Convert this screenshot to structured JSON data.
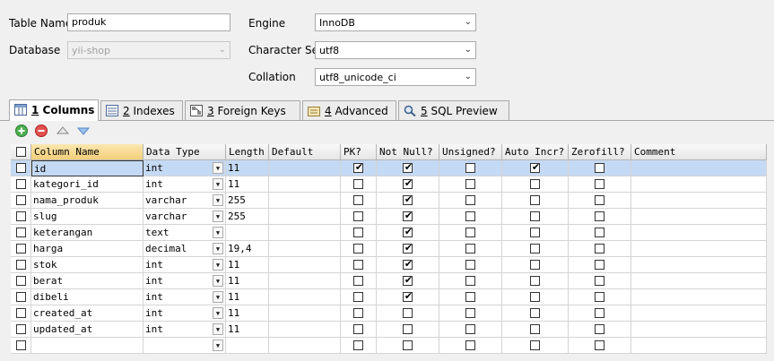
{
  "form": {
    "table_name_label": "Table Name",
    "table_name_value": "produk",
    "database_label": "Database",
    "database_value": "yii-shop",
    "engine_label": "Engine",
    "engine_value": "InnoDB",
    "charset_label": "Character Set",
    "charset_value": "utf8",
    "collation_label": "Collation",
    "collation_value": "utf8_unicode_ci"
  },
  "tabs": [
    {
      "num": "1",
      "label": " Columns",
      "icon": "columns-icon",
      "active": true
    },
    {
      "num": "2",
      "label": " Indexes",
      "icon": "indexes-icon",
      "active": false
    },
    {
      "num": "3",
      "label": " Foreign Keys",
      "icon": "foreign-keys-icon",
      "active": false
    },
    {
      "num": "4",
      "label": " Advanced",
      "icon": "advanced-icon",
      "active": false
    },
    {
      "num": "5",
      "label": " SQL Preview",
      "icon": "sql-preview-icon",
      "active": false
    }
  ],
  "toolbar": [
    "add-column-icon",
    "delete-column-icon",
    "move-up-icon",
    "move-down-icon"
  ],
  "columns_header": [
    "Column Name",
    "Data Type",
    "Length",
    "Default",
    "PK?",
    "Not Null?",
    "Unsigned?",
    "Auto Incr?",
    "Zerofill?",
    "Comment"
  ],
  "rows": [
    {
      "name": "id",
      "type": "int",
      "length": "11",
      "default": "",
      "pk": true,
      "notnull": true,
      "unsigned": false,
      "autoinc": true,
      "zerofill": false,
      "comment": ""
    },
    {
      "name": "kategori_id",
      "type": "int",
      "length": "11",
      "default": "",
      "pk": false,
      "notnull": true,
      "unsigned": false,
      "autoinc": false,
      "zerofill": false,
      "comment": ""
    },
    {
      "name": "nama_produk",
      "type": "varchar",
      "length": "255",
      "default": "",
      "pk": false,
      "notnull": true,
      "unsigned": false,
      "autoinc": false,
      "zerofill": false,
      "comment": ""
    },
    {
      "name": "slug",
      "type": "varchar",
      "length": "255",
      "default": "",
      "pk": false,
      "notnull": true,
      "unsigned": false,
      "autoinc": false,
      "zerofill": false,
      "comment": ""
    },
    {
      "name": "keterangan",
      "type": "text",
      "length": "",
      "default": "",
      "pk": false,
      "notnull": true,
      "unsigned": false,
      "autoinc": false,
      "zerofill": false,
      "comment": ""
    },
    {
      "name": "harga",
      "type": "decimal",
      "length": "19,4",
      "default": "",
      "pk": false,
      "notnull": true,
      "unsigned": false,
      "autoinc": false,
      "zerofill": false,
      "comment": ""
    },
    {
      "name": "stok",
      "type": "int",
      "length": "11",
      "default": "",
      "pk": false,
      "notnull": true,
      "unsigned": false,
      "autoinc": false,
      "zerofill": false,
      "comment": ""
    },
    {
      "name": "berat",
      "type": "int",
      "length": "11",
      "default": "",
      "pk": false,
      "notnull": true,
      "unsigned": false,
      "autoinc": false,
      "zerofill": false,
      "comment": ""
    },
    {
      "name": "dibeli",
      "type": "int",
      "length": "11",
      "default": "",
      "pk": false,
      "notnull": true,
      "unsigned": false,
      "autoinc": false,
      "zerofill": false,
      "comment": ""
    },
    {
      "name": "created_at",
      "type": "int",
      "length": "11",
      "default": "",
      "pk": false,
      "notnull": false,
      "unsigned": false,
      "autoinc": false,
      "zerofill": false,
      "comment": ""
    },
    {
      "name": "updated_at",
      "type": "int",
      "length": "11",
      "default": "",
      "pk": false,
      "notnull": false,
      "unsigned": false,
      "autoinc": false,
      "zerofill": false,
      "comment": ""
    },
    {
      "name": "",
      "type": "",
      "length": "",
      "default": "",
      "pk": false,
      "notnull": false,
      "unsigned": false,
      "autoinc": false,
      "zerofill": false,
      "comment": ""
    }
  ],
  "selected_row": 0
}
